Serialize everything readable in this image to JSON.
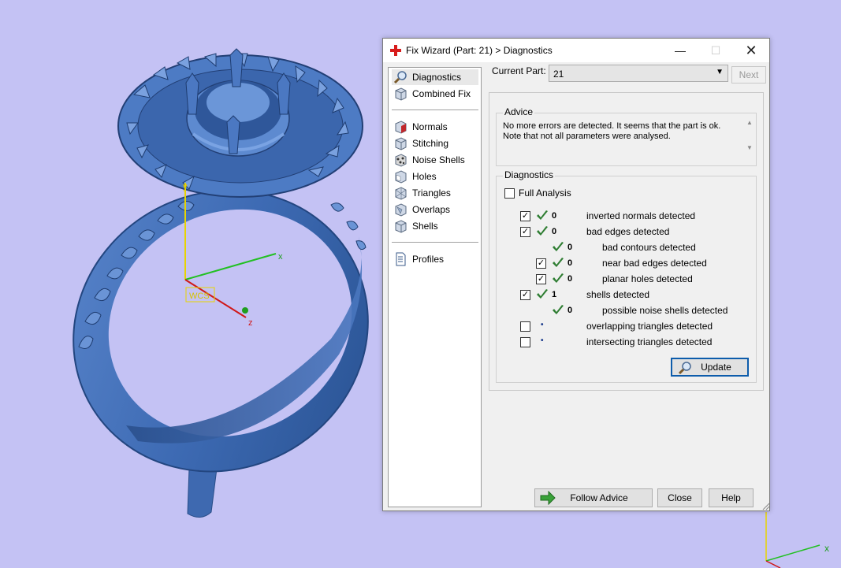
{
  "colors": {
    "background": "#c4c2f4",
    "model": "#3f6db5",
    "check": "#2e7d32",
    "accent": "#0d5cab"
  },
  "axes": {
    "x": "x",
    "y": "y",
    "z": "z",
    "origin_label": "WCS"
  },
  "dialog": {
    "title": "Fix Wizard (Part: 21) > Diagnostics",
    "title_icon": "red-cross-icon",
    "window_buttons": {
      "minimize": "—",
      "maximize": "☐",
      "close": "✕"
    },
    "nav": {
      "items": [
        {
          "label": "Diagnostics",
          "icon": "magnifier-icon",
          "selected": true
        },
        {
          "label": "Combined Fix",
          "icon": "cube-icon"
        },
        {
          "label": "Normals",
          "icon": "normals-cube-icon"
        },
        {
          "label": "Stitching",
          "icon": "stitching-cube-icon"
        },
        {
          "label": "Noise Shells",
          "icon": "noise-shells-icon"
        },
        {
          "label": "Holes",
          "icon": "holes-cube-icon"
        },
        {
          "label": "Triangles",
          "icon": "triangles-cube-icon"
        },
        {
          "label": "Overlaps",
          "icon": "overlaps-cube-icon"
        },
        {
          "label": "Shells",
          "icon": "shells-cube-icon"
        },
        {
          "label": "Profiles",
          "icon": "document-icon"
        }
      ]
    },
    "current_part": {
      "label": "Current Part:",
      "value": "21",
      "next": "Next"
    },
    "advice": {
      "title": "Advice",
      "text_line1": "No more errors are detected. It seems that the part is ok.",
      "text_line2": "Note that not all parameters were analysed."
    },
    "diagnostics": {
      "title": "Diagnostics",
      "full_analysis": {
        "label": "Full Analysis",
        "checked": false
      },
      "rows": [
        {
          "checkbox": true,
          "checked": true,
          "status": "check",
          "count": "0",
          "label": "inverted normals detected",
          "indent": 0
        },
        {
          "checkbox": true,
          "checked": true,
          "status": "check",
          "count": "0",
          "label": "bad edges detected",
          "indent": 0
        },
        {
          "checkbox": false,
          "checked": false,
          "status": "check",
          "count": "0",
          "label": "bad contours detected",
          "indent": 1
        },
        {
          "checkbox": true,
          "checked": true,
          "status": "check",
          "count": "0",
          "label": "near bad edges detected",
          "indent": 1
        },
        {
          "checkbox": true,
          "checked": true,
          "status": "check",
          "count": "0",
          "label": "planar holes detected",
          "indent": 1
        },
        {
          "checkbox": true,
          "checked": true,
          "status": "check",
          "count": "1",
          "label": "shells detected",
          "indent": 0
        },
        {
          "checkbox": false,
          "checked": false,
          "status": "check",
          "count": "0",
          "label": "possible noise shells detected",
          "indent": 1
        },
        {
          "checkbox": true,
          "checked": false,
          "status": "dot",
          "count": "",
          "label": "overlapping triangles detected",
          "indent": 0
        },
        {
          "checkbox": true,
          "checked": false,
          "status": "dot",
          "count": "",
          "label": "intersecting triangles detected",
          "indent": 0
        }
      ],
      "update": "Update"
    },
    "footer": {
      "follow_advice": "Follow Advice",
      "close": "Close",
      "help": "Help"
    }
  }
}
